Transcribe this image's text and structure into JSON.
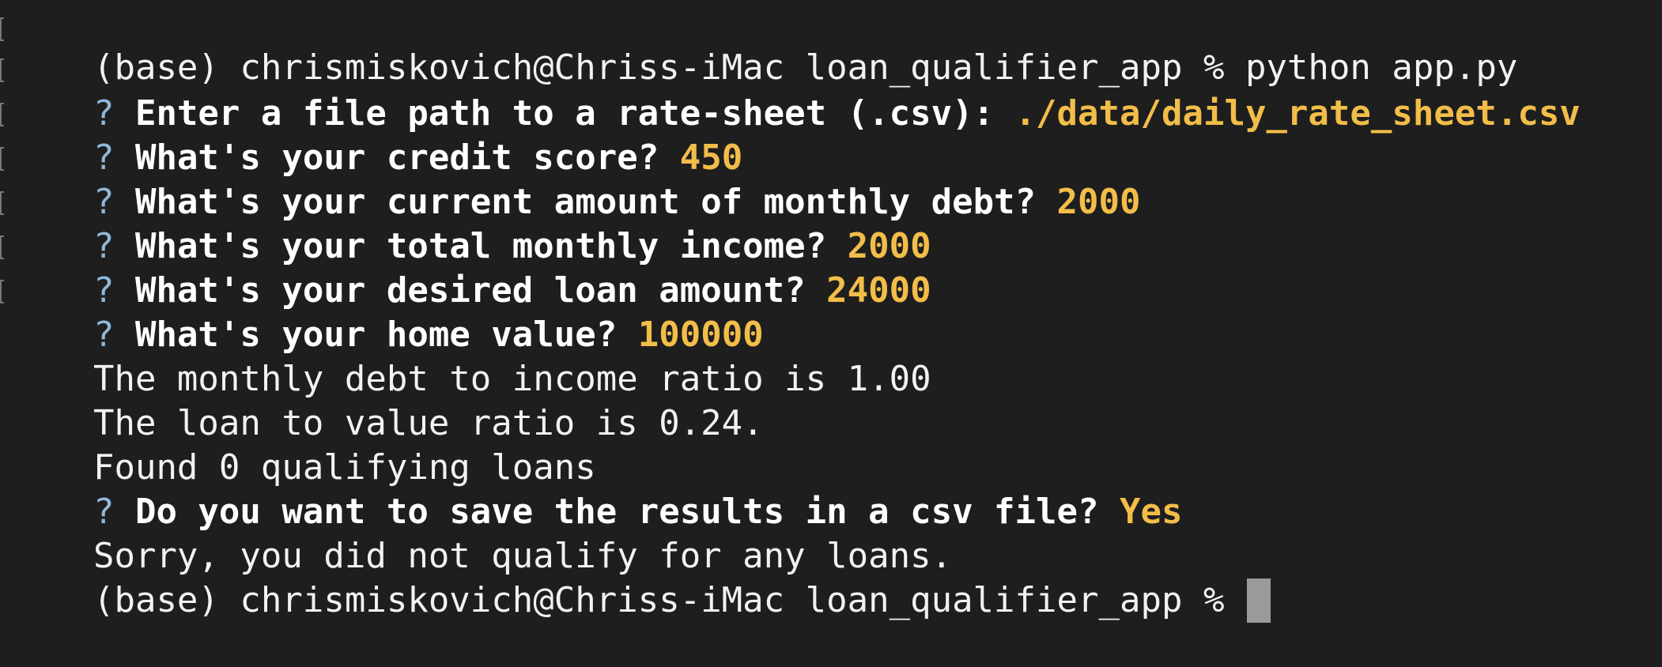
{
  "terminal": {
    "lines": [
      {
        "kind": "command",
        "prompt": "(base) chrismiskovich@Chriss-iMac loan_qualifier_app % ",
        "command": "python app.py"
      },
      {
        "kind": "question",
        "q": "?",
        "text": " Enter a file path to a rate-sheet (.csv): ",
        "answer": "./data/daily_rate_sheet.csv"
      },
      {
        "kind": "question",
        "q": "?",
        "text": " What's your credit score? ",
        "answer": "450"
      },
      {
        "kind": "question",
        "q": "?",
        "text": " What's your current amount of monthly debt? ",
        "answer": "2000"
      },
      {
        "kind": "question",
        "q": "?",
        "text": " What's your total monthly income? ",
        "answer": "2000"
      },
      {
        "kind": "question",
        "q": "?",
        "text": " What's your desired loan amount? ",
        "answer": "24000"
      },
      {
        "kind": "question",
        "q": "?",
        "text": " What's your home value? ",
        "answer": "100000"
      },
      {
        "kind": "output",
        "text": "The monthly debt to income ratio is 1.00"
      },
      {
        "kind": "output",
        "text": "The loan to value ratio is 0.24."
      },
      {
        "kind": "output",
        "text": "Found 0 qualifying loans"
      },
      {
        "kind": "question",
        "q": "?",
        "text": " Do you want to save the results in a csv file? ",
        "answer": "Yes"
      },
      {
        "kind": "output",
        "text": "Sorry, you did not qualify for any loans."
      },
      {
        "kind": "prompt",
        "prompt": "(base) chrismiskovich@Chriss-iMac loan_qualifier_app % "
      }
    ]
  },
  "colors": {
    "background": "#1e1e1e",
    "text": "#f2f2f2",
    "answer": "#f2bd49",
    "question_mark": "#8fb7d9",
    "cursor": "#9a9a9a"
  }
}
